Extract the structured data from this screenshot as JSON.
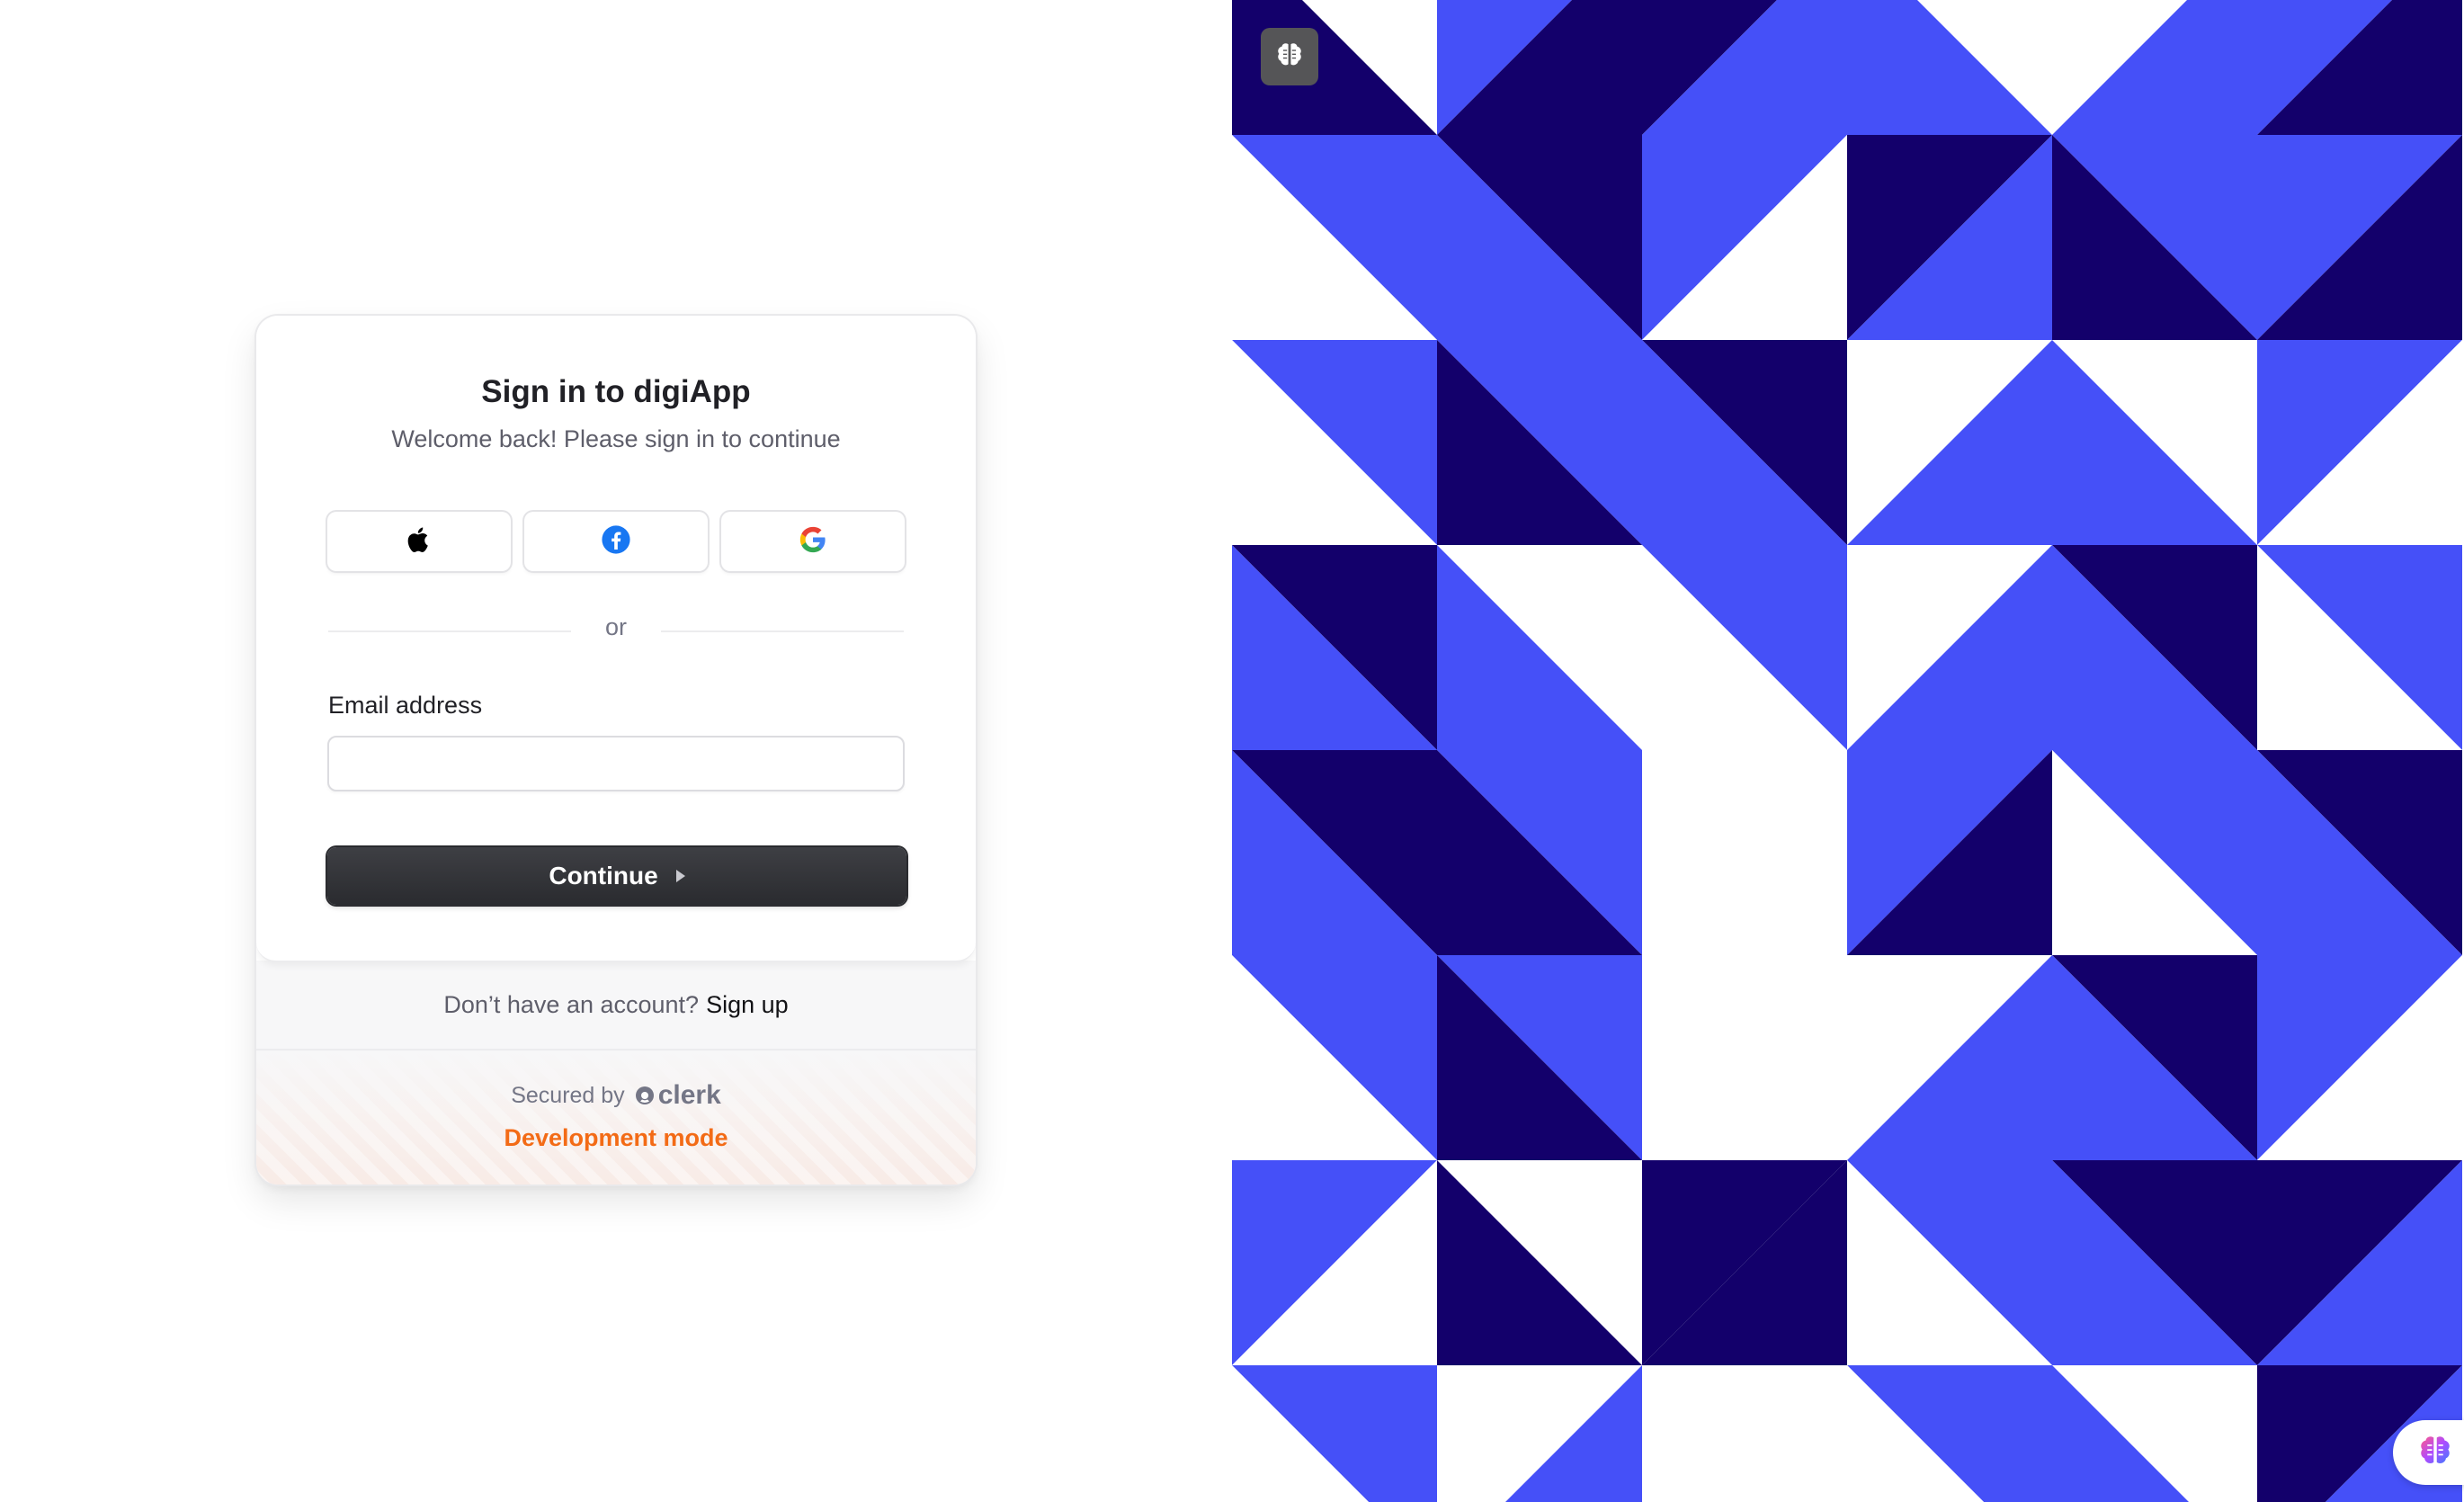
{
  "signin": {
    "title": "Sign in to digiApp",
    "subtitle": "Welcome back! Please sign in to continue",
    "divider": "or",
    "email_label": "Email address",
    "email_value": "",
    "email_placeholder": "",
    "continue_label": "Continue"
  },
  "social": [
    {
      "provider": "Apple",
      "icon": "apple-icon"
    },
    {
      "provider": "Facebook",
      "icon": "facebook-icon"
    },
    {
      "provider": "Google",
      "icon": "google-icon"
    }
  ],
  "footer": {
    "no_account": "Don’t have an account?",
    "signup_link": "Sign up",
    "secured_by": "Secured by",
    "brand": "clerk",
    "dev_mode": "Development mode"
  },
  "colors": {
    "pattern_light": "#4550f8",
    "pattern_dark": "#13006b",
    "pattern_white": "#ffffff",
    "dev_mode": "#f36b16",
    "button_dark": "#2f3035"
  },
  "icons": {
    "top_badge": "brain-icon",
    "floating_widget": "brain-icon"
  }
}
